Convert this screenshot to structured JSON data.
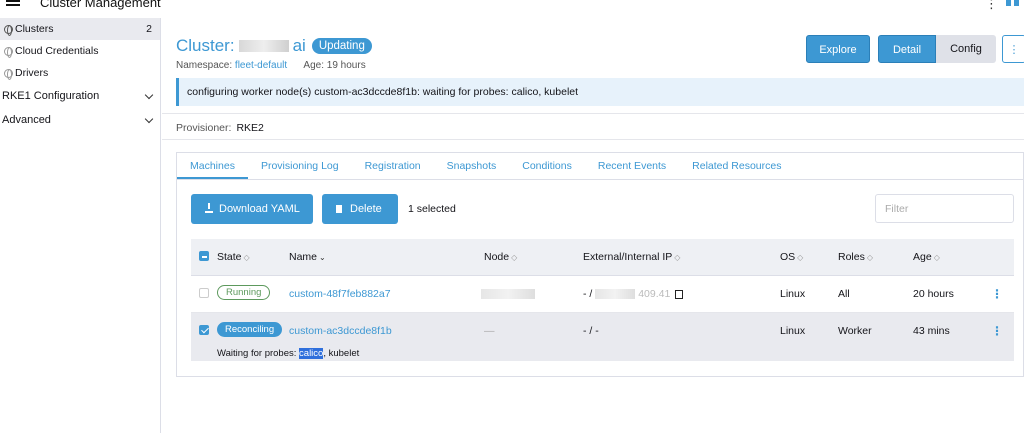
{
  "topbar": {
    "title": "Cluster Management"
  },
  "sidebar": {
    "items": [
      {
        "label": "Clusters",
        "count": "2"
      },
      {
        "label": "Cloud Credentials"
      },
      {
        "label": "Drivers"
      }
    ],
    "groups": [
      {
        "label": "RKE1 Configuration"
      },
      {
        "label": "Advanced"
      }
    ]
  },
  "header": {
    "title_prefix": "Cluster:",
    "title_suffix": "ai",
    "status": "Updating",
    "namespace_label": "Namespace:",
    "namespace_value": "fleet-default",
    "age_label": "Age:",
    "age_value": "19 hours",
    "buttons": {
      "explore": "Explore",
      "detail": "Detail",
      "config": "Config",
      "more": "⋮"
    }
  },
  "banner": {
    "message": "configuring worker node(s) custom-ac3dccde8f1b: waiting for probes: calico, kubelet"
  },
  "provisioner": {
    "label": "Provisioner:",
    "value": "RKE2"
  },
  "tabs": [
    "Machines",
    "Provisioning Log",
    "Registration",
    "Snapshots",
    "Conditions",
    "Recent Events",
    "Related Resources"
  ],
  "actions": {
    "download": "Download YAML",
    "delete": "Delete",
    "selected_count": "1 selected",
    "filter_placeholder": "Filter"
  },
  "table": {
    "columns": [
      "State",
      "Name",
      "Node",
      "External/Internal IP",
      "OS",
      "Roles",
      "Age"
    ],
    "rows": [
      {
        "state": "Running",
        "name": "custom-48f7feb882a7",
        "node": "",
        "ip_prefix": "- /",
        "ip_suffix": "409.41",
        "os": "Linux",
        "roles": "All",
        "age": "20 hours"
      },
      {
        "state": "Reconciling",
        "name": "custom-ac3dccde8f1b",
        "node": "—",
        "ip": "- / -",
        "os": "Linux",
        "roles": "Worker",
        "age": "43 mins",
        "detail_prefix": "Waiting for probes: ",
        "detail_highlight": "calico",
        "detail_suffix": ", kubelet"
      }
    ]
  },
  "colors": {
    "accent": "#3d98d3",
    "running": "#5d995d"
  }
}
